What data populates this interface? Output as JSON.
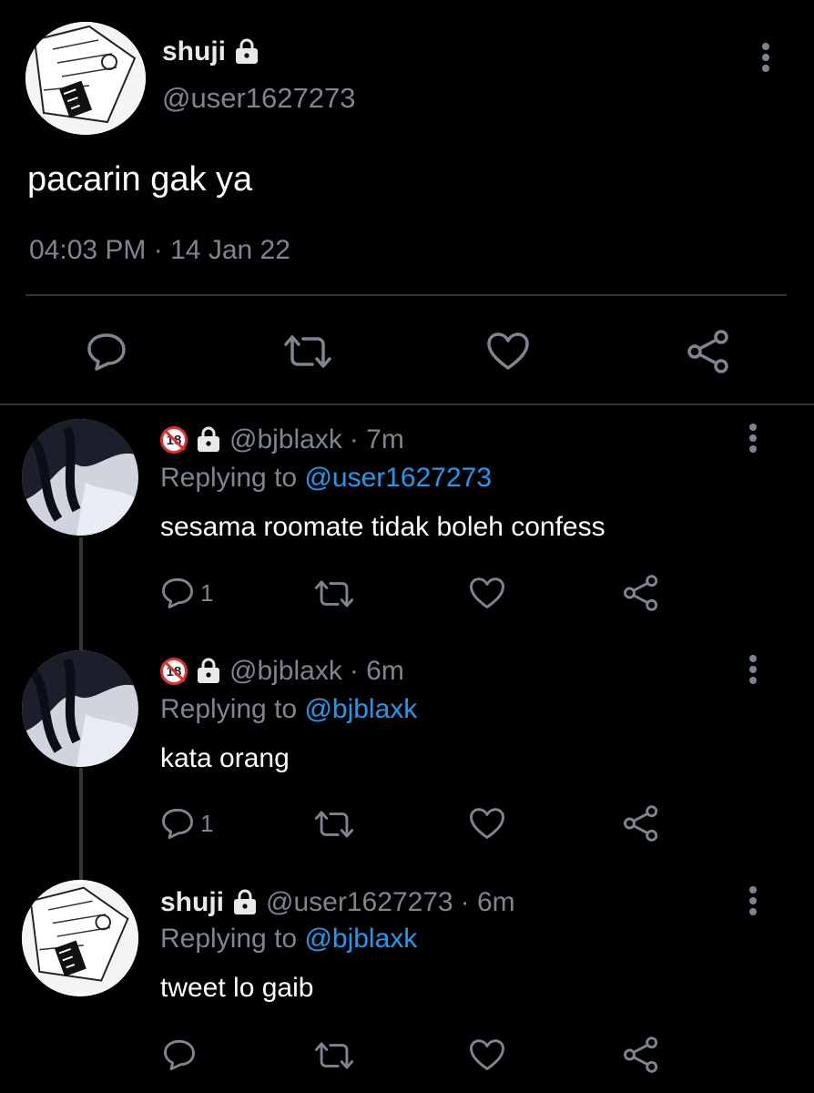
{
  "main_tweet": {
    "name": "shuji",
    "handle": "@user1627273",
    "text": "pacarin gak ya",
    "time": "04:03 PM",
    "separator": "·",
    "date": "14 Jan 22"
  },
  "replies": [
    {
      "badge": "18",
      "handle": "@bjblaxk",
      "age": "· 7m",
      "replying_label": "Replying to",
      "replying_to": "@user1627273",
      "text": "sesama roomate tidak boleh confess",
      "reply_count": "1"
    },
    {
      "badge": "18",
      "handle": "@bjblaxk",
      "age": "· 6m",
      "replying_label": "Replying to",
      "replying_to": "@bjblaxk",
      "text": "kata orang",
      "reply_count": "1"
    },
    {
      "name": "shuji",
      "handle": "@user1627273",
      "age": "· 6m",
      "replying_label": "Replying to",
      "replying_to": "@bjblaxk",
      "text": "tweet lo gaib"
    }
  ],
  "icons": [
    "lock-icon",
    "more-icon",
    "reply-icon",
    "retweet-icon",
    "like-icon",
    "share-icon",
    "no-under-18-icon"
  ],
  "colors": {
    "background": "#000000",
    "text": "#e7e9ea",
    "muted": "#7d868f",
    "link": "#1d9bf0"
  }
}
